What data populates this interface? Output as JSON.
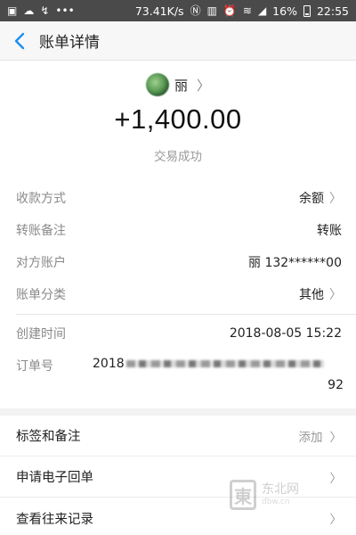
{
  "status_bar": {
    "speed": "73.41K/s",
    "battery": "16%",
    "time": "22:55"
  },
  "nav": {
    "back_icon": "chevron-left-icon",
    "title": "账单详情"
  },
  "bill": {
    "payer_name": "丽",
    "amount": "+1,400.00",
    "status": "交易成功"
  },
  "details": [
    {
      "label": "收款方式",
      "value": "余额",
      "has_chevron": true
    },
    {
      "label": "转账备注",
      "value": "转账",
      "has_chevron": false
    },
    {
      "label": "对方账户",
      "value": "丽 132******00",
      "has_chevron": false
    },
    {
      "label": "账单分类",
      "value": "其他",
      "has_chevron": true
    }
  ],
  "order_info": {
    "created_label": "创建时间",
    "created_value": "2018-08-05 15:22",
    "order_label": "订单号",
    "order_prefix": "2018",
    "order_suffix": "92"
  },
  "actions": [
    {
      "label": "标签和备注",
      "right_text": "添加"
    },
    {
      "label": "申请电子回单",
      "right_text": ""
    },
    {
      "label": "查看往来记录",
      "right_text": ""
    }
  ],
  "watermark": {
    "text": "东北网",
    "url": "dbw.cn"
  },
  "colors": {
    "accent": "#1a8ff2",
    "status_bar": "#4a4a4a"
  }
}
